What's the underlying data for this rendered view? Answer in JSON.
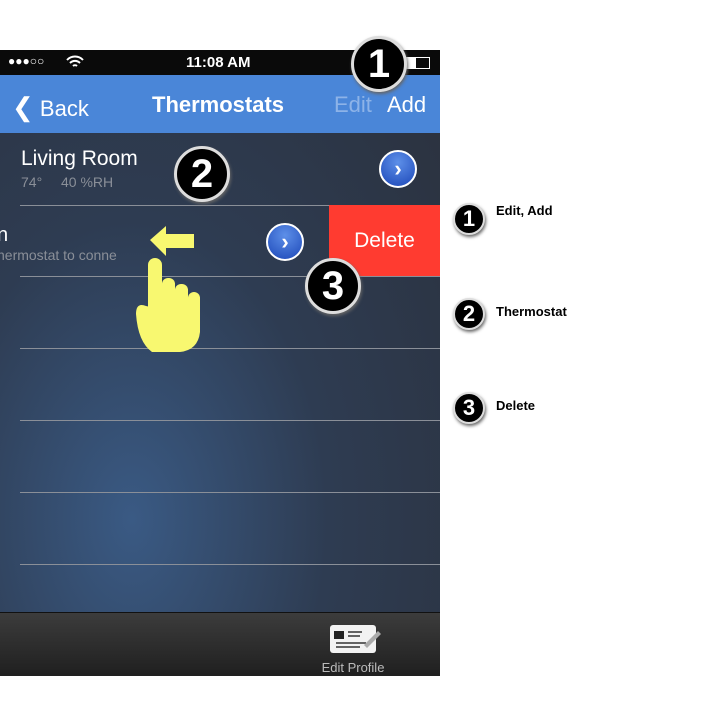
{
  "status": {
    "signal": "●●●○○",
    "time": "11:08 AM",
    "wifi_icon": "wifi-icon",
    "battery_icon": "battery-icon"
  },
  "nav": {
    "back": "Back",
    "title": "Thermostats",
    "edit": "Edit",
    "add": "Add",
    "color": "#4a86d8"
  },
  "rows": [
    {
      "name": "Living Room",
      "temp": "74°",
      "humidity": "40 %RH"
    },
    {
      "name": "n",
      "sub": "hermostat to conne",
      "delete": "Delete",
      "delete_color": "#ff3b30"
    }
  ],
  "tabbar": {
    "edit_profile": "Edit Profile"
  },
  "callouts": [
    {
      "num": "1",
      "label": "Edit, Add"
    },
    {
      "num": "2",
      "label": "Thermostat"
    },
    {
      "num": "3",
      "label": "Delete"
    }
  ]
}
